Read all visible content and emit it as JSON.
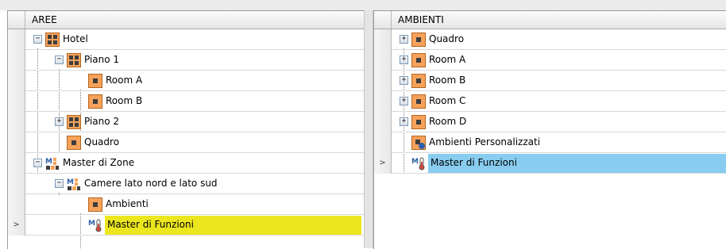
{
  "left_tree": {
    "header": "AREE",
    "rows": [
      {
        "label": "Hotel",
        "icon": "area-grid-icon",
        "expander": "−",
        "selected": false
      },
      {
        "label": "Piano 1",
        "icon": "area-grid-icon",
        "expander": "−",
        "selected": false
      },
      {
        "label": "Room A",
        "icon": "room-icon",
        "expander": "",
        "selected": false
      },
      {
        "label": "Room B",
        "icon": "room-icon",
        "expander": "",
        "selected": false
      },
      {
        "label": "Piano 2",
        "icon": "area-grid-icon",
        "expander": "+",
        "selected": false
      },
      {
        "label": "Quadro",
        "icon": "room-icon",
        "expander": "",
        "selected": false
      },
      {
        "label": "Master di Zone",
        "icon": "master-zone-icon",
        "expander": "−",
        "selected": false
      },
      {
        "label": "Camere lato nord e lato sud",
        "icon": "master-zone-icon",
        "expander": "−",
        "selected": false
      },
      {
        "label": "Ambienti",
        "icon": "room-icon",
        "expander": "",
        "selected": false
      },
      {
        "label": "Master di Funzioni",
        "icon": "master-function-icon",
        "expander": "",
        "selected": true,
        "row_indicator": ">"
      }
    ]
  },
  "right_tree": {
    "header": "AMBIENTI",
    "rows": [
      {
        "label": "Quadro",
        "icon": "room-icon",
        "expander": "+",
        "selected": false
      },
      {
        "label": "Room A",
        "icon": "room-icon",
        "expander": "+",
        "selected": false
      },
      {
        "label": "Room B",
        "icon": "room-icon",
        "expander": "+",
        "selected": false
      },
      {
        "label": "Room C",
        "icon": "room-icon",
        "expander": "+",
        "selected": false
      },
      {
        "label": "Room D",
        "icon": "room-icon",
        "expander": "+",
        "selected": false
      },
      {
        "label": "Ambienti Personalizzati",
        "icon": "custom-room-icon",
        "expander": "",
        "selected": false
      },
      {
        "label": "Master di Funzioni",
        "icon": "master-function-icon",
        "expander": "",
        "selected": true,
        "row_indicator": ">"
      }
    ]
  },
  "colors": {
    "left_selection": "#ece61f",
    "right_selection": "#88cdf0",
    "icon_orange": "#f7a25a",
    "icon_dark": "#3d3d3d"
  }
}
